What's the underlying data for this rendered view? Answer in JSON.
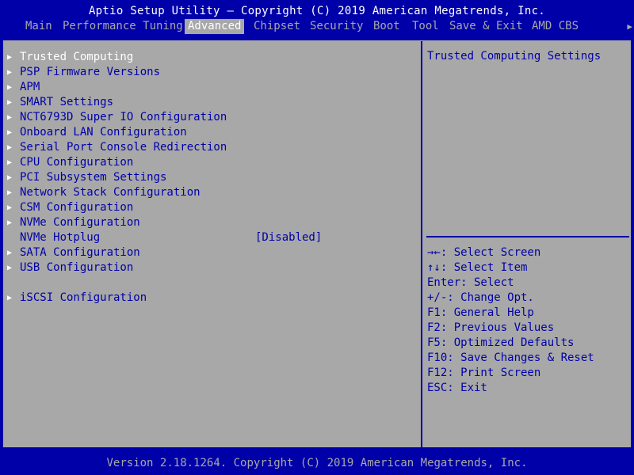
{
  "header": {
    "title": "Aptio Setup Utility – Copyright (C) 2019 American Megatrends, Inc."
  },
  "tabs": [
    {
      "label": "Main"
    },
    {
      "label": "Performance Tuning"
    },
    {
      "label": "Advanced",
      "active": true
    },
    {
      "label": "Chipset"
    },
    {
      "label": "Security"
    },
    {
      "label": "Boot"
    },
    {
      "label": "Tool"
    },
    {
      "label": "Save & Exit"
    },
    {
      "label": "AMD CBS"
    }
  ],
  "menu": {
    "items": [
      {
        "label": "Trusted Computing",
        "submenu": true,
        "selected": true
      },
      {
        "label": "PSP Firmware Versions",
        "submenu": true
      },
      {
        "label": "APM",
        "submenu": true
      },
      {
        "label": "SMART Settings",
        "submenu": true
      },
      {
        "label": "NCT6793D Super IO Configuration",
        "submenu": true
      },
      {
        "label": "Onboard LAN Configuration",
        "submenu": true
      },
      {
        "label": "Serial Port Console Redirection",
        "submenu": true
      },
      {
        "label": "CPU Configuration",
        "submenu": true
      },
      {
        "label": "PCI Subsystem Settings",
        "submenu": true
      },
      {
        "label": "Network Stack Configuration",
        "submenu": true
      },
      {
        "label": "CSM Configuration",
        "submenu": true
      },
      {
        "label": "NVMe Configuration",
        "submenu": true
      },
      {
        "label": "NVMe Hotplug",
        "value": "[Disabled]"
      },
      {
        "label": "SATA Configuration",
        "submenu": true
      },
      {
        "label": "USB Configuration",
        "submenu": true
      },
      {
        "label": "iSCSI Configuration",
        "submenu": true
      }
    ]
  },
  "help": {
    "title": "Trusted Computing Settings",
    "keys": [
      "→←: Select Screen",
      "↑↓: Select Item",
      "Enter: Select",
      "+/-: Change Opt.",
      "F1: General Help",
      "F2: Previous Values",
      "F5: Optimized Defaults",
      "F10: Save Changes & Reset",
      "F12: Print Screen",
      "ESC: Exit"
    ]
  },
  "footer": {
    "text": "Version 2.18.1264. Copyright (C) 2019 American Megatrends, Inc."
  },
  "colors": {
    "background": "#0000a8",
    "panel": "#a8a8a8",
    "text_blue": "#0000a8",
    "text_white": "#ffffff"
  },
  "icons": {
    "submenu": "triangle-right-icon",
    "more_tabs": "triangle-right-icon"
  }
}
